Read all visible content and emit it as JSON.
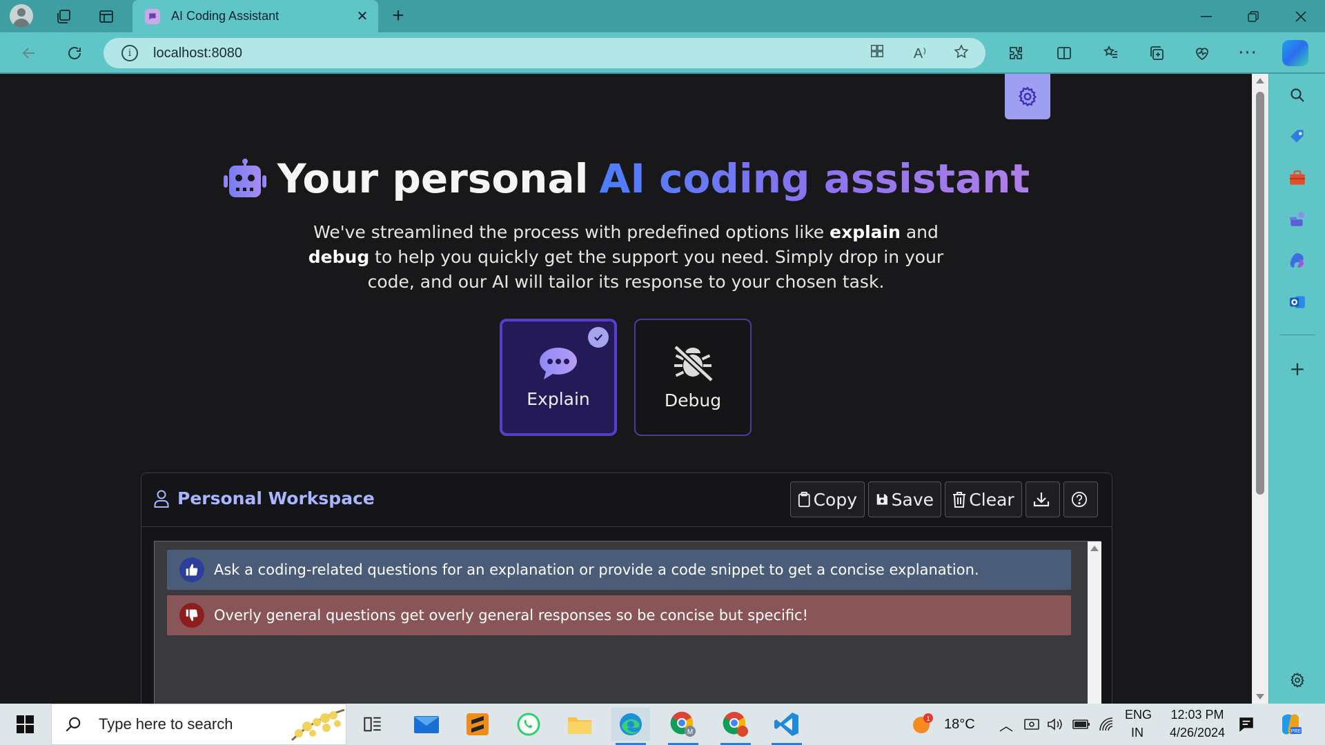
{
  "browser": {
    "tab_title": "AI Coding Assistant",
    "url": "localhost:8080"
  },
  "hero": {
    "title_plain": "Your personal",
    "title_accent": "AI coding assistant",
    "desc_1": "We've streamlined the process with predefined options like ",
    "desc_bold_1": "explain",
    "desc_2": " and ",
    "desc_bold_2": "debug",
    "desc_3": " to help you quickly get the support you need. Simply drop in your code, and our AI will tailor its response to your chosen task."
  },
  "modes": [
    {
      "label": "Explain",
      "selected": true,
      "icon": "chat-bubble-icon"
    },
    {
      "label": "Debug",
      "selected": false,
      "icon": "bug-slash-icon"
    }
  ],
  "workspace": {
    "title": "Personal Workspace",
    "copy_label": "Copy",
    "save_label": "Save",
    "clear_label": "Clear",
    "tip_good": "Ask a coding-related questions for an explanation or provide a code snippet to get a concise explanation.",
    "tip_bad": "Overly general questions get overly general responses so be concise but specific!"
  },
  "taskbar": {
    "search_placeholder": "Type here to search",
    "weather": "18°C",
    "weather_badge": "1",
    "lang_1": "ENG",
    "lang_2": "IN",
    "time": "12:03 PM",
    "date": "4/26/2024"
  },
  "colors": {
    "accent_purple": "#8a73ee",
    "accent_blue": "#4c7dfa",
    "titlebar": "#3f9ea1",
    "toolbar": "#5fc5c7",
    "tip_good_bg": "#4a5c78",
    "tip_bad_bg": "#8a5559"
  }
}
